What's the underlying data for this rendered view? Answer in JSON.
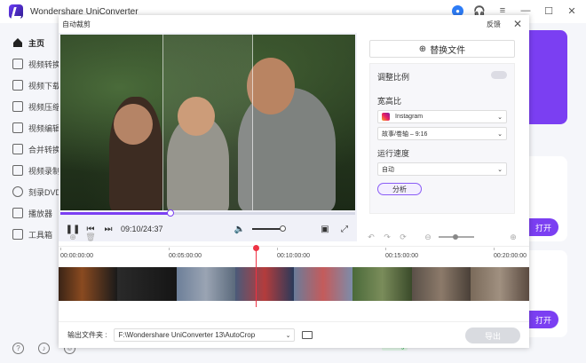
{
  "app": {
    "title": "Wondershare UniConverter",
    "user_initial": "👤"
  },
  "sidebar": {
    "items": [
      {
        "label": "主页",
        "icon": "home-icon",
        "active": true
      },
      {
        "label": "视频转换",
        "icon": "video-convert-icon"
      },
      {
        "label": "视频下载",
        "icon": "download-icon"
      },
      {
        "label": "视频压缩",
        "icon": "compress-icon"
      },
      {
        "label": "视频编辑",
        "icon": "scissors-icon"
      },
      {
        "label": "合并转换",
        "icon": "merge-icon"
      },
      {
        "label": "视频录制",
        "icon": "record-icon"
      },
      {
        "label": "刻录DVD",
        "icon": "dvd-icon"
      },
      {
        "label": "播放器",
        "icon": "player-icon"
      },
      {
        "label": "工具箱",
        "icon": "toolbox-icon"
      }
    ]
  },
  "background": {
    "open_button_1": "打开",
    "open_button_2": "打开",
    "badge": "Getting"
  },
  "dialog": {
    "title": "自动裁剪",
    "feedback": "反馈",
    "player": {
      "time": "09:10/24:37",
      "progress": 0.37,
      "volume": 0.92
    },
    "panel": {
      "replace_file": "替换文件",
      "aspect_toggle_label": "调整比例",
      "aspect_label": "宽高比",
      "platform": "Instagram",
      "ratio": "故事/卷轴 – 9:16",
      "speed_label": "运行速度",
      "speed": "自动",
      "analyze": "分析"
    },
    "timeline": {
      "ticks": [
        "00:00:00:00",
        "00:05:00:00",
        "00:10:00:00",
        "00:15:00:00",
        "00:20:00:00"
      ],
      "playhead_time": 0.37
    },
    "footer": {
      "output_label": "输出文件夹 :",
      "path": "F:\\Wondershare UniConverter 13\\AutoCrop",
      "export": "导出"
    }
  }
}
